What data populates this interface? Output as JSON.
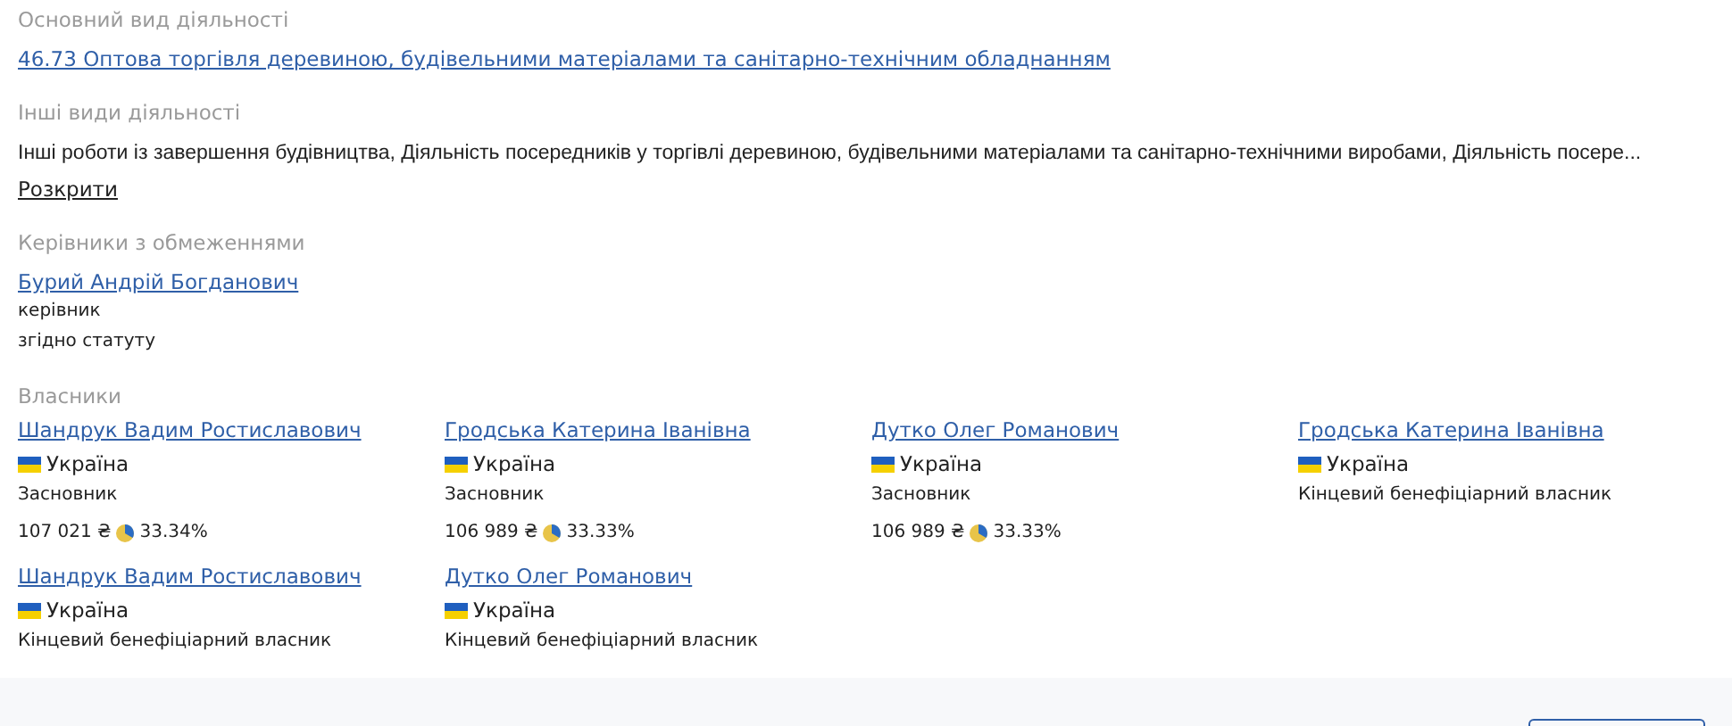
{
  "main_activity": {
    "label": "Основний вид діяльності",
    "link": "46.73 Оптова торгівля деревиною, будівельними матеріалами та санітарно-технічним обладнанням"
  },
  "other_activities": {
    "label": "Інші види діяльності",
    "text": "Інші роботи із завершення будівництва, Діяльність посередників у торгівлі деревиною, будівельними матеріалами та санітарно-технічними виробами, Діяльність посере...",
    "expand": "Розкрити"
  },
  "managers": {
    "label": "Керівники з обмеженнями",
    "items": [
      {
        "name": "Бурий Андрій Богданович",
        "role": "керівник",
        "basis": "згідно статуту"
      }
    ]
  },
  "owners": {
    "label": "Власники",
    "items": [
      {
        "name": "Шандрук Вадим Ростиславович",
        "country": "Україна",
        "role": "Засновник",
        "amount": "107 021 ₴",
        "share": "33.34%"
      },
      {
        "name": "Гродська Катерина Іванівна",
        "country": "Україна",
        "role": "Засновник",
        "amount": "106 989 ₴",
        "share": "33.33%"
      },
      {
        "name": "Дутко Олег Романович",
        "country": "Україна",
        "role": "Засновник",
        "amount": "106 989 ₴",
        "share": "33.33%"
      },
      {
        "name": "Гродська Катерина Іванівна",
        "country": "Україна",
        "role": "Кінцевий бенефіціарний власник"
      },
      {
        "name": "Шандрук Вадим Ростиславович",
        "country": "Україна",
        "role": "Кінцевий бенефіціарний власник"
      },
      {
        "name": "Дутко Олег Романович",
        "country": "Україна",
        "role": "Кінцевий бенефіціарний власник"
      }
    ]
  }
}
